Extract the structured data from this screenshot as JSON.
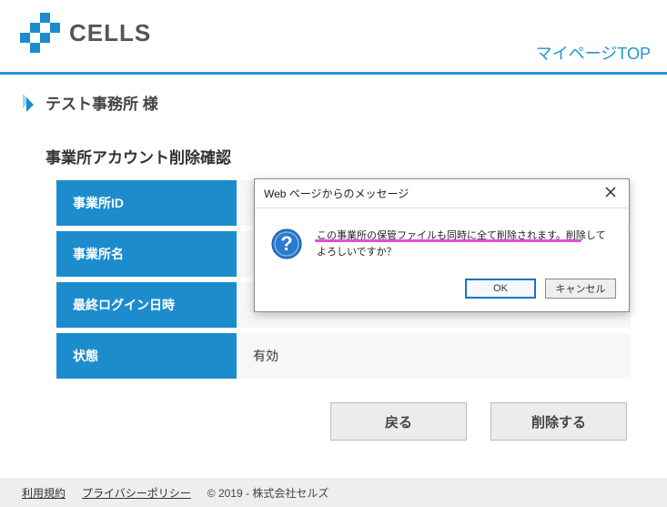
{
  "header": {
    "brand_text": "CELLS",
    "mypage_link": "マイページTOP"
  },
  "greeting": {
    "office_name": "テスト事務所 様"
  },
  "section": {
    "title": "事業所アカウント削除確認"
  },
  "fields": {
    "id_label": "事業所ID",
    "id_value": "",
    "name_label": "事業所名",
    "name_value": "",
    "last_login_label": "最終ログイン日時",
    "last_login_value": "",
    "status_label": "状態",
    "status_value": "有効"
  },
  "actions": {
    "back": "戻る",
    "delete": "削除する"
  },
  "footer": {
    "terms": "利用規約",
    "privacy": "プライバシーポリシー",
    "copyright": "© 2019 - 株式会社セルズ"
  },
  "dialog": {
    "title": "Web ページからのメッセージ",
    "message": "この事業所の保管ファイルも同時に全て削除されます。削除してよろしいですか？",
    "ok": "OK",
    "cancel": "キャンセル"
  }
}
